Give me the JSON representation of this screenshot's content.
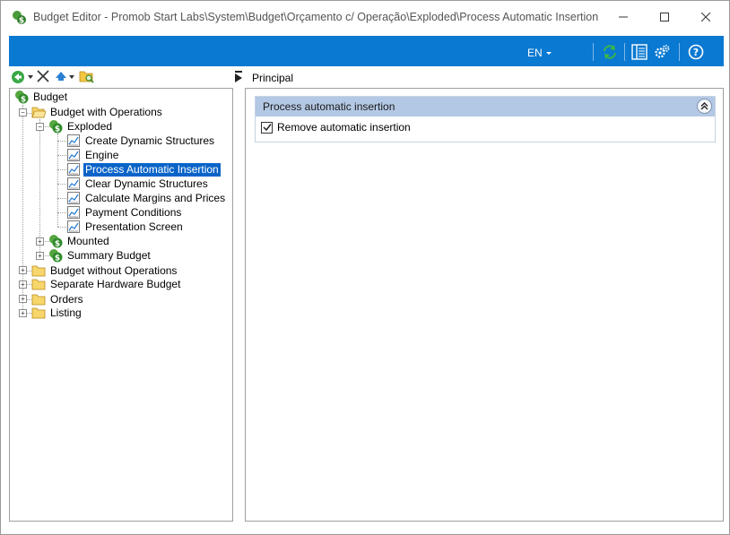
{
  "window": {
    "title": "Budget Editor - Promob Start Labs\\System\\Budget\\Orçamento c/ Operação\\Exploded\\Process Automatic Insertion"
  },
  "toolbar": {
    "language": "EN",
    "icons": [
      "refresh-icon",
      "layout-icon",
      "settings-gears-icon",
      "help-icon"
    ]
  },
  "left_toolbar": {
    "icons": [
      "back-icon",
      "delete-icon",
      "move-up-icon",
      "folder-search-icon"
    ]
  },
  "tree": {
    "root": "Budget",
    "budget_with_operations": "Budget with Operations",
    "exploded": "Exploded",
    "exploded_children": [
      "Create Dynamic Structures",
      "Engine",
      "Process Automatic Insertion",
      "Clear Dynamic Structures",
      "Calculate Margins and Prices",
      "Payment Conditions",
      "Presentation Screen"
    ],
    "selected": "Process Automatic Insertion",
    "mounted": "Mounted",
    "summary_budget": "Summary Budget",
    "top_folders": [
      "Budget without Operations",
      "Separate Hardware Budget",
      "Orders",
      "Listing"
    ]
  },
  "right": {
    "tab": "Principal",
    "group_title": "Process automatic insertion",
    "checkbox_label": "Remove automatic insertion",
    "checkbox_checked": true
  },
  "colors": {
    "toolbar_blue": "#0a79d2",
    "selection": "#0a64c8",
    "group_header": "#b3c8e4",
    "refresh_green": "#3bb54a"
  }
}
